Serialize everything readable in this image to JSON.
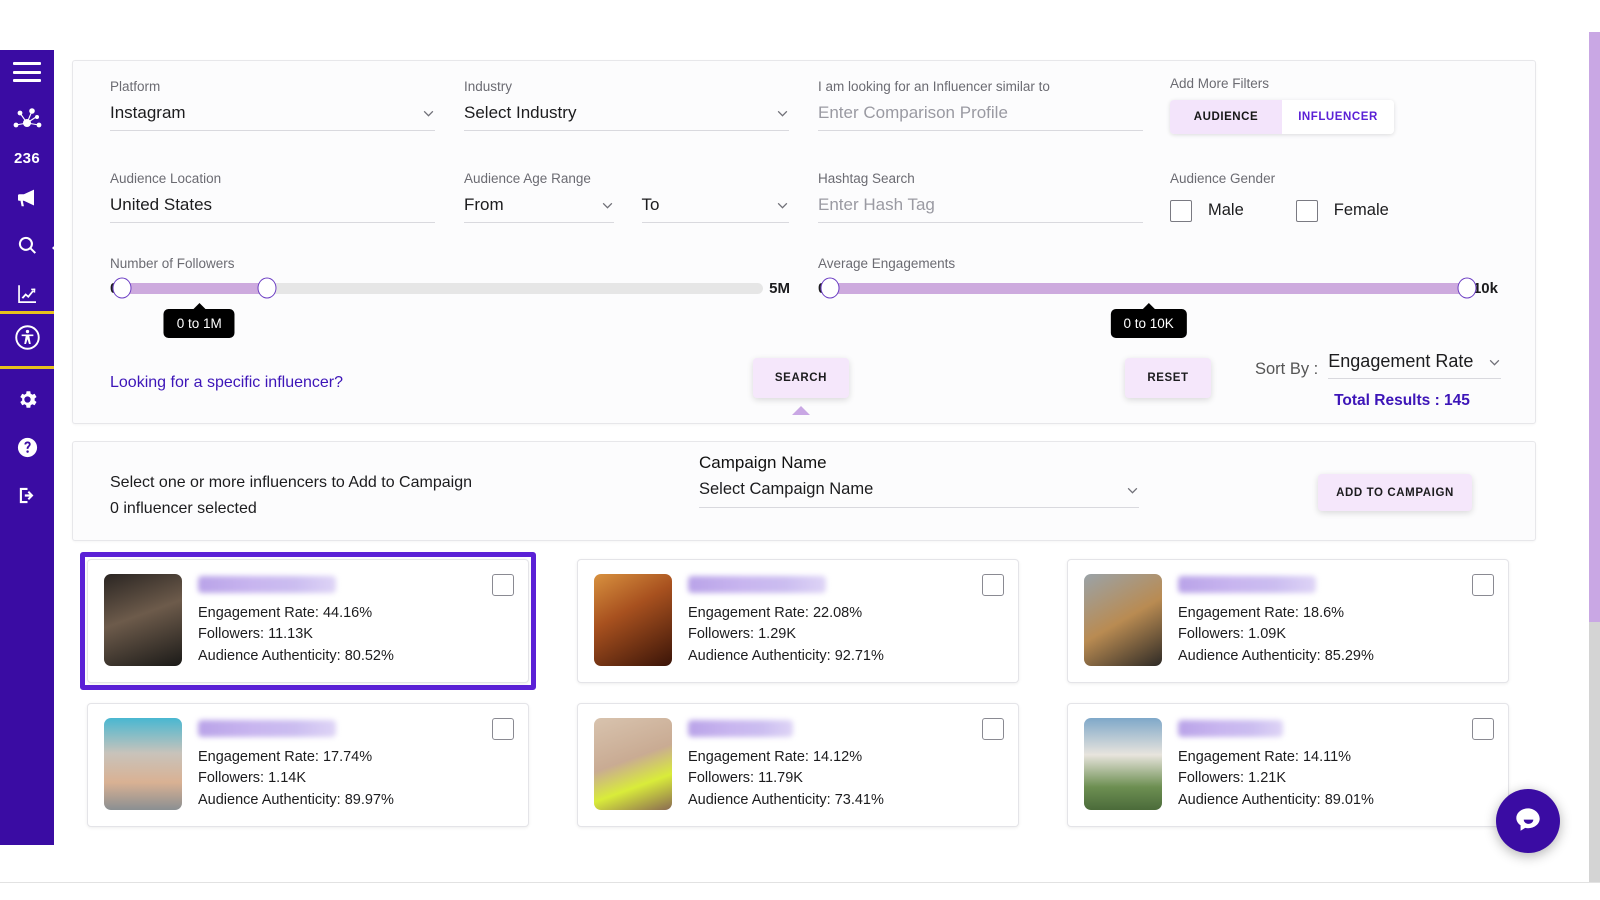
{
  "sidebar": {
    "notification_count": "236",
    "items": [
      {
        "name": "menu-toggle",
        "icon": "hamburger-icon"
      },
      {
        "name": "brand-logo",
        "icon": "network-dots-logo"
      },
      {
        "name": "campaign",
        "icon": "megaphone-icon"
      },
      {
        "name": "discovery-search",
        "icon": "search-icon",
        "active": true
      },
      {
        "name": "analytics",
        "icon": "chart-line-icon"
      },
      {
        "name": "accessibility",
        "icon": "accessibility-icon"
      },
      {
        "name": "settings",
        "icon": "gear-icon"
      },
      {
        "name": "help",
        "icon": "question-circle-icon"
      },
      {
        "name": "logout",
        "icon": "logout-icon"
      }
    ]
  },
  "filters": {
    "platform": {
      "label": "Platform",
      "value": "Instagram"
    },
    "industry": {
      "label": "Industry",
      "value": "Select Industry"
    },
    "similar_to": {
      "label": "I am looking for an Influencer similar to",
      "placeholder": "Enter Comparison Profile",
      "value": ""
    },
    "add_more_filters": {
      "label": "Add More Filters",
      "audience_tab": "AUDIENCE",
      "influencer_tab": "INFLUENCER",
      "active_tab": "AUDIENCE"
    },
    "audience_location": {
      "label": "Audience Location",
      "value": "United States"
    },
    "audience_age_range": {
      "label": "Audience Age Range",
      "from": "From",
      "to": "To"
    },
    "hashtag_search": {
      "label": "Hashtag Search",
      "placeholder": "Enter Hash Tag",
      "value": ""
    },
    "audience_gender": {
      "label": "Audience Gender",
      "male": "Male",
      "female": "Female",
      "male_checked": false,
      "female_checked": false
    },
    "followers": {
      "label": "Number of Followers",
      "min_label": "0",
      "max_label": "5M",
      "tooltip": "0 to 1M",
      "fill_start_pct": 0,
      "fill_end_pct": 22.5
    },
    "engagements": {
      "label": "Average Engagements",
      "min_label": "0",
      "max_label": "10k",
      "tooltip": "0 to 10K",
      "fill_start_pct": 0,
      "fill_end_pct": 100
    }
  },
  "actions": {
    "specific_influencer_link": "Looking for a specific influencer?",
    "search_button": "SEARCH",
    "reset_button": "RESET",
    "sort_by_label": "Sort By :",
    "sort_by_value": "Engagement Rate",
    "total_results": "Total Results : 145"
  },
  "campaign_bar": {
    "instruction": "Select one or more influencers to Add to Campaign",
    "selected_count_text": "0 influencer selected",
    "campaign_name_label": "Campaign Name",
    "campaign_name_value": "Select Campaign Name",
    "add_button": "ADD TO CAMPAIGN"
  },
  "influencers": [
    {
      "handle": "",
      "engagement_label": "Engagement Rate: 44.16%",
      "followers_label": "Followers: 11.13K",
      "authenticity_label": "Audience Authenticity: 80.52%",
      "selected": true,
      "checked": false,
      "avatar_colors": [
        "#1b1a18",
        "#6d5b4b",
        "#2a2522"
      ]
    },
    {
      "handle": "",
      "engagement_label": "Engagement Rate: 22.08%",
      "followers_label": "Followers: 1.29K",
      "authenticity_label": "Audience Authenticity: 92.71%",
      "selected": false,
      "checked": false,
      "avatar_colors": [
        "#7d3a18",
        "#d8913f",
        "#3a1408"
      ]
    },
    {
      "handle": "",
      "engagement_label": "Engagement Rate: 18.6%",
      "followers_label": "Followers: 1.09K",
      "authenticity_label": "Audience Authenticity: 85.29%",
      "selected": false,
      "checked": false,
      "avatar_colors": [
        "#6b6257",
        "#b98b52",
        "#2e2a26"
      ]
    },
    {
      "handle": "",
      "engagement_label": "Engagement Rate: 17.74%",
      "followers_label": "Followers: 1.14K",
      "authenticity_label": "Audience Authenticity: 89.97%",
      "selected": false,
      "checked": false,
      "avatar_colors": [
        "#49b7d1",
        "#d9b193",
        "#8a8f92"
      ]
    },
    {
      "handle": "",
      "engagement_label": "Engagement Rate: 14.12%",
      "followers_label": "Followers: 11.79K",
      "authenticity_label": "Audience Authenticity: 73.41%",
      "selected": false,
      "checked": false,
      "avatar_colors": [
        "#c9ab93",
        "#d9ec3a",
        "#6b4a3a"
      ]
    },
    {
      "handle": "",
      "engagement_label": "Engagement Rate: 14.11%",
      "followers_label": "Followers: 1.21K",
      "authenticity_label": "Audience Authenticity: 89.01%",
      "selected": false,
      "checked": false,
      "avatar_colors": [
        "#7fa8c9",
        "#e8e4dd",
        "#4b6b3a"
      ]
    }
  ],
  "chat_widget": {
    "icon": "chat-bubble-icon"
  },
  "colors": {
    "brand_purple": "#3a0ca3",
    "accent_violet": "#5b21d6",
    "lilac_button": "#f5e7fb",
    "slider_fill": "#cdaade",
    "divider_yellow": "#e8c21c"
  }
}
